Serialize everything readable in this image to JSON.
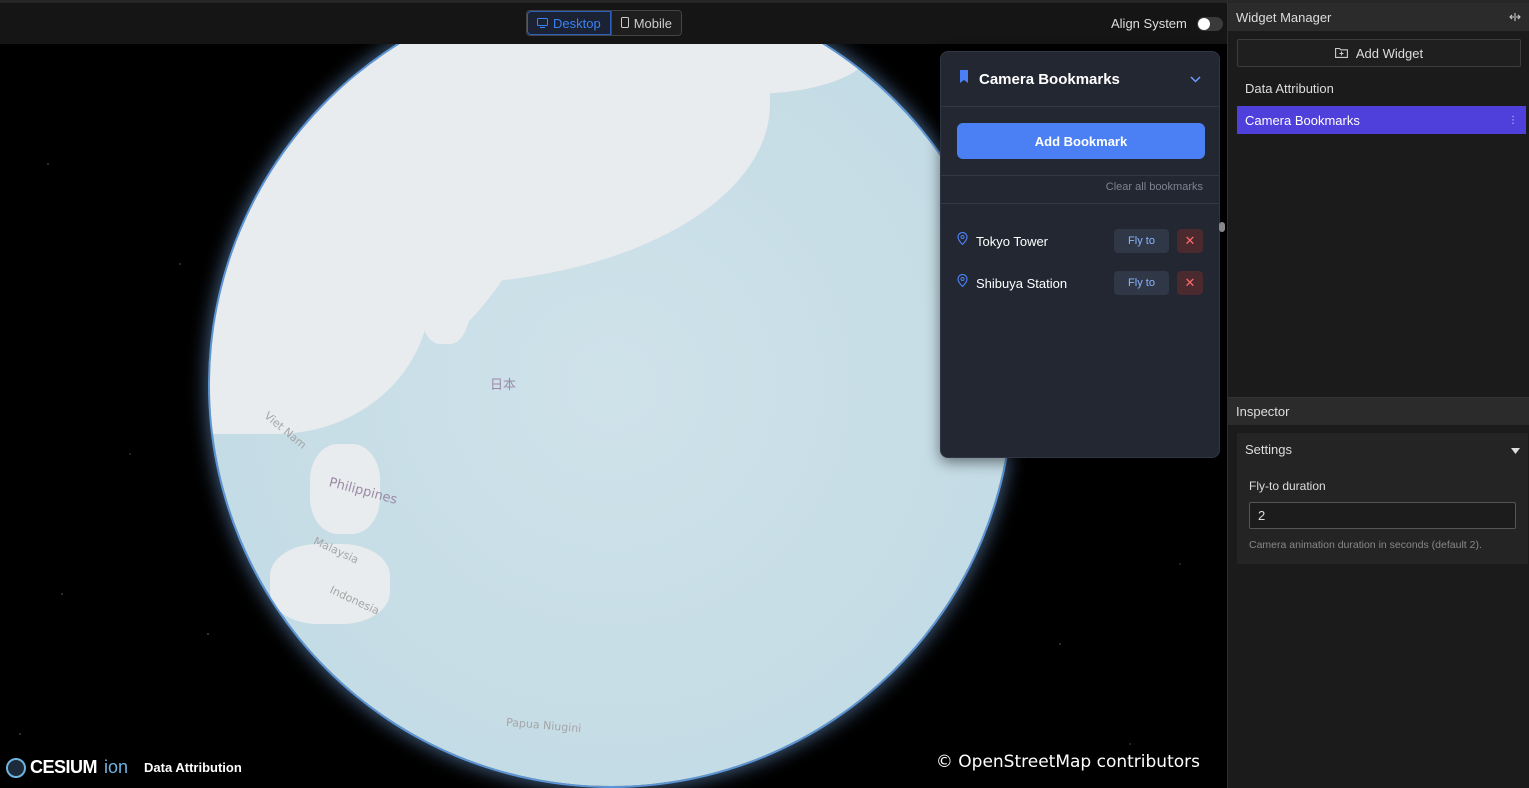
{
  "toolbar": {
    "desktop_label": "Desktop",
    "mobile_label": "Mobile",
    "align_label": "Align System",
    "align_enabled": false
  },
  "map": {
    "labels": [
      "日本",
      "Philippines",
      "Viet Nam",
      "Malaysia",
      "Indonesia",
      "Papua Niugini"
    ],
    "attribution": "© OpenStreetMap contributors"
  },
  "footer": {
    "brand": "CESIUM",
    "brand_suffix": "ion",
    "data_attribution": "Data Attribution"
  },
  "bookmarks": {
    "title": "Camera Bookmarks",
    "add_label": "Add Bookmark",
    "clear_label": "Clear all bookmarks",
    "items": [
      {
        "name": "Tokyo Tower",
        "fly_label": "Fly to"
      },
      {
        "name": "Shibuya Station",
        "fly_label": "Fly to"
      }
    ],
    "accent_color": "#4b80f5"
  },
  "widget_manager": {
    "title": "Widget Manager",
    "add_label": "Add Widget",
    "widgets": [
      {
        "label": "Data Attribution",
        "active": false
      },
      {
        "label": "Camera Bookmarks",
        "active": true
      }
    ],
    "active_color": "#4f3fdb"
  },
  "inspector": {
    "title": "Inspector",
    "section_title": "Settings",
    "field_label": "Fly-to duration",
    "field_value": "2",
    "field_help": "Camera animation duration in seconds (default 2)."
  }
}
